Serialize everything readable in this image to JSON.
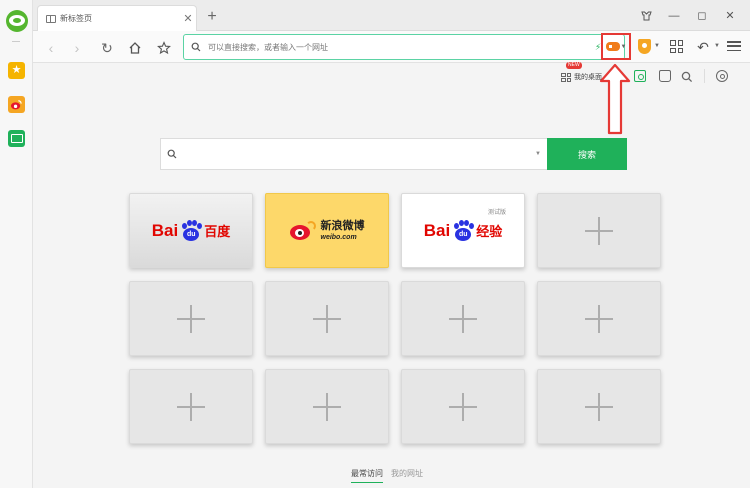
{
  "tab": {
    "title": "新标签页"
  },
  "address_bar": {
    "placeholder": "可以直接搜索，或者输入一个网址"
  },
  "page_toolbar": {
    "desk_label": "我的桌面",
    "new_badge": "NEW"
  },
  "search": {
    "button_label": "搜索"
  },
  "tiles": {
    "baidu": {
      "brand": "Bai",
      "paw_text": "du",
      "cn": "百度"
    },
    "weibo": {
      "cn": "新浪微博",
      "en": "weibo.com"
    },
    "jingyan": {
      "brand": "Bai",
      "paw_text": "du",
      "cn": "经验",
      "small": "测试版"
    }
  },
  "bottom_tabs": [
    "最常访问",
    "我的网址"
  ],
  "colors": {
    "accent_green": "#1fb15a",
    "annotation_red": "#e53935",
    "baidu_red": "#e10601",
    "baidu_blue": "#2932e1",
    "weibo_yellow": "#fdd86a"
  },
  "icons": [
    "browser-logo",
    "favorites-icon",
    "weibo-icon",
    "folder-icon",
    "back-icon",
    "forward-icon",
    "refresh-icon",
    "home-icon",
    "star-icon",
    "search-icon",
    "gamepad-icon",
    "shield-icon",
    "grid-icon",
    "undo-icon",
    "menu-icon",
    "camera-icon",
    "bag-icon",
    "settings-icon",
    "plus-icon"
  ]
}
